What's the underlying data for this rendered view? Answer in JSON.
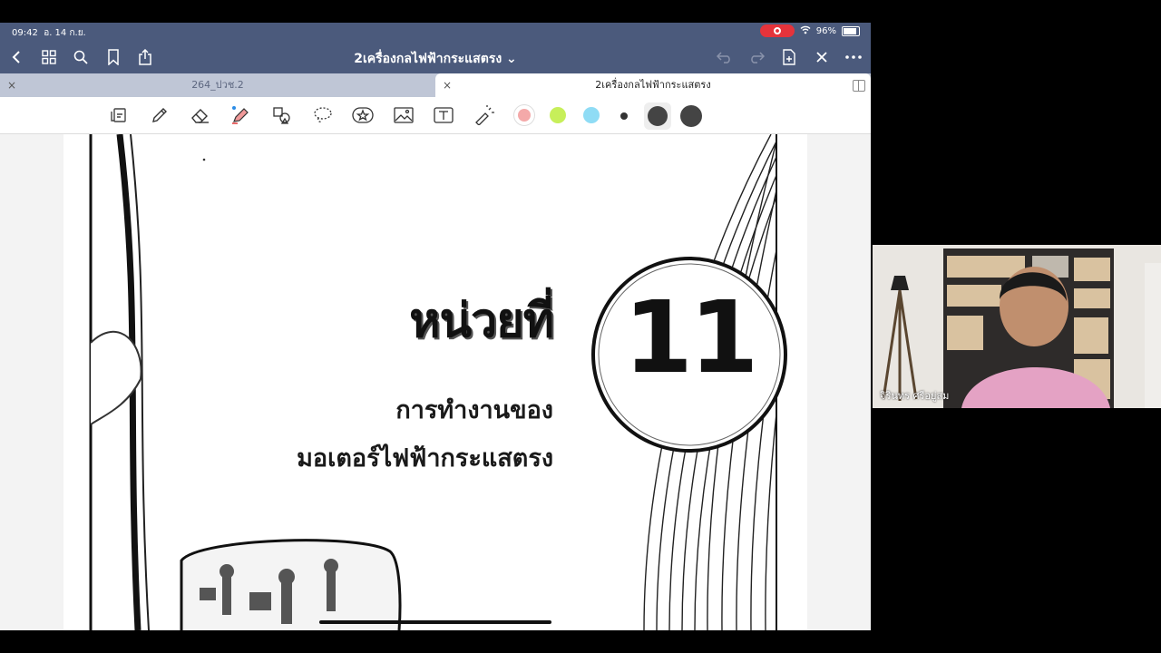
{
  "status_bar": {
    "time": "09:42",
    "date": "อ. 14 ก.ย.",
    "battery": "96%"
  },
  "nav": {
    "doc_title": "2เครื่องกลไฟฟ้ากระแสตรง ⌄"
  },
  "tabs": [
    {
      "label": "264_ปวช.2",
      "close": "×"
    },
    {
      "label": "2เครื่องกลไฟฟ้ากระแสตรง",
      "close": "×"
    }
  ],
  "toolbar": {
    "tools": [
      "scan-icon",
      "pen-icon",
      "eraser-icon",
      "highlighter-icon",
      "shapes-icon",
      "lasso-icon",
      "sticker-icon",
      "image-icon",
      "text-icon",
      "laser-pointer-icon"
    ],
    "colors": [
      "#f4a9a9",
      "#c7ef5a",
      "#8fdcf5",
      "#333333",
      "#444444",
      "#444444"
    ]
  },
  "document": {
    "unit_title": "หน่วยที่",
    "unit_number": "11",
    "subtitle_line1": "การทำงานของ",
    "subtitle_line2": "มอเตอร์ไฟฟ้ากระแสตรง"
  },
  "video": {
    "participant_name": "จิรินทร ศรีอยู่สม"
  }
}
